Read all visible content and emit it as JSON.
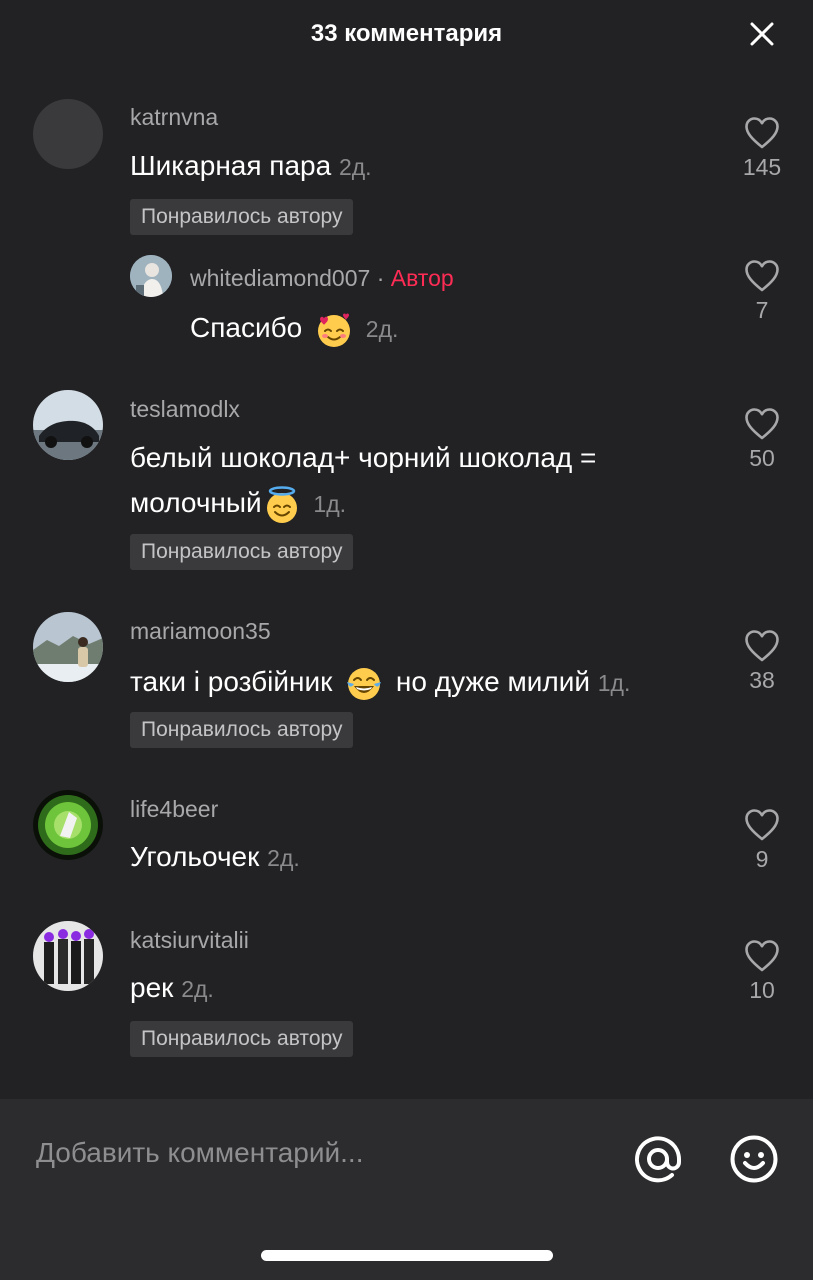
{
  "header": {
    "title": "33 комментария"
  },
  "comments": [
    {
      "username": "katrnvna",
      "text": "Шикарная пара",
      "time": "2д.",
      "liked_label": "Понравилось автору",
      "likes": "145",
      "reply": {
        "username": "whitediamond007",
        "separator": "·",
        "author_label": "Автор",
        "text": "Спасибо",
        "emoji": "smiling-face-with-hearts",
        "time": "2д.",
        "likes": "7"
      }
    },
    {
      "username": "teslamodlx",
      "text_line1": "белый шоколад+ чорний шоколад =",
      "text_line2": "молочный",
      "emoji": "smiling-face-with-halo",
      "time": "1д.",
      "liked_label": "Понравилось автору",
      "likes": "50"
    },
    {
      "username": "mariamoon35",
      "text_before": "таки і розбійник",
      "emoji": "face-with-tears-of-joy",
      "text_after": "но дуже милий",
      "time": "1д.",
      "liked_label": "Понравилось автору",
      "likes": "38"
    },
    {
      "username": "life4beer",
      "text": "Угольочек",
      "time": "2д.",
      "likes": "9"
    },
    {
      "username": "katsiurvitalii",
      "text": "рек",
      "time": "2д.",
      "liked_label": "Понравилось автору",
      "likes": "10"
    }
  ],
  "input": {
    "placeholder": "Добавить комментарий..."
  },
  "icons": {
    "close": "close-icon",
    "like": "heart-outline-icon",
    "mention": "at-sign-icon",
    "emoji": "smiley-icon"
  },
  "colors": {
    "background": "#222224",
    "input_bar": "#2c2c2e",
    "author_tag": "#fe2c55",
    "badge_bg": "#3a3a3c"
  }
}
